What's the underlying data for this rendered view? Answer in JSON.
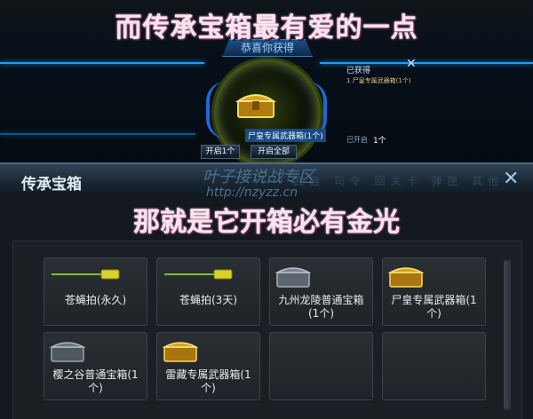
{
  "top_caption": "而传承宝箱最有爱的一点",
  "bottom_caption": "那就是它开箱必有金光",
  "reward_popup": {
    "banner": "恭喜你获得",
    "item_label": "尸皇专属武器箱(1个)",
    "open_one_button": "开启1个",
    "open_all_button": "开启全部",
    "side_title": "已获得",
    "side_row": "1  尸皇专属武器箱(1个)",
    "opened_label": "已开启",
    "opened_count": "1个",
    "close_icon": "✕"
  },
  "window": {
    "title": "传承宝箱",
    "close_icon": "✕",
    "bg_tabs": "武器 司令 回关卡 弹匣 其他",
    "watermark_line1": "叶子接说战专区",
    "watermark_line2": "http://nzyzz.cn"
  },
  "inventory": [
    {
      "label": "苍蝇拍(永久)",
      "icon": "swatter-icon"
    },
    {
      "label": "苍蝇拍(3天)",
      "icon": "swatter-icon"
    },
    {
      "label": "九州龙陵普通宝箱\n(1个)",
      "icon": "silver-chest-icon"
    },
    {
      "label": "尸皇专属武器箱(1\n个)",
      "icon": "gold-chest-icon"
    },
    {
      "label": "樱之谷普通宝箱(1\n个)",
      "icon": "silver-chest-icon"
    },
    {
      "label": "雷藏专属武器箱(1\n个)",
      "icon": "gold-chest-icon"
    },
    {
      "label": "",
      "icon": ""
    },
    {
      "label": "",
      "icon": ""
    }
  ],
  "colors": {
    "caption": "#ffe1f0",
    "hud_blue": "#1aa0ff",
    "gold": "#d8a21c",
    "silver": "#8a949e",
    "swatter_green": "#7fbf2a"
  }
}
